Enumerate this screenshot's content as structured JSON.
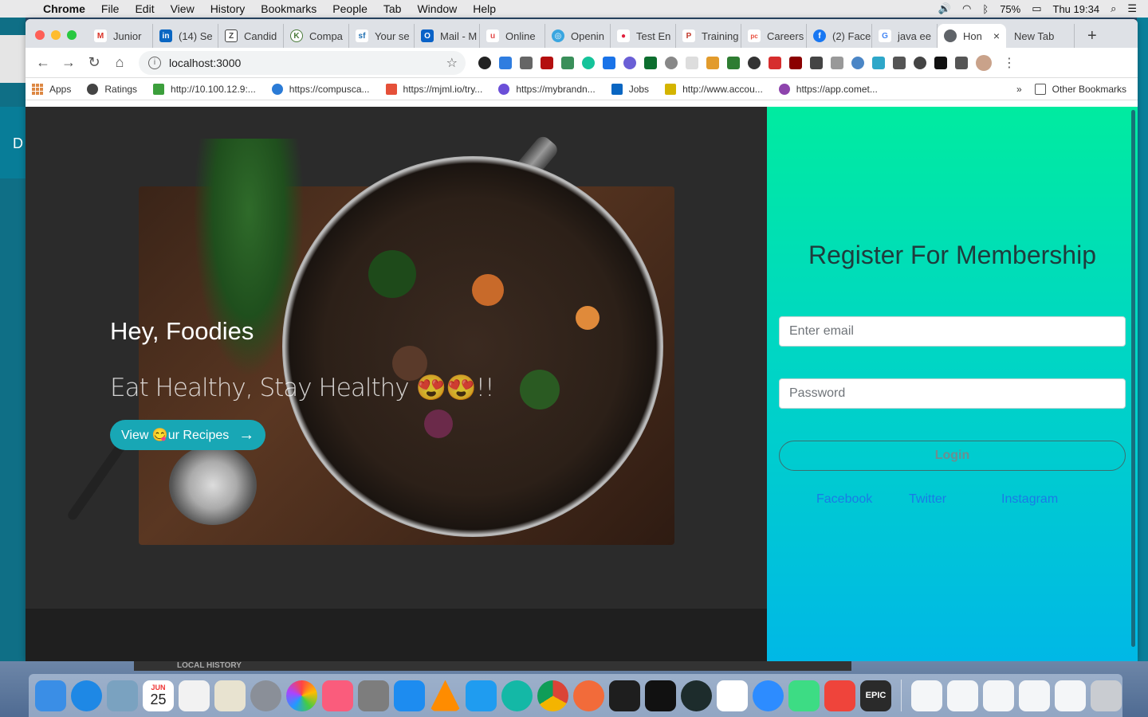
{
  "menubar": {
    "app_name": "Chrome",
    "items": [
      "File",
      "Edit",
      "View",
      "History",
      "Bookmarks",
      "People",
      "Tab",
      "Window",
      "Help"
    ],
    "battery": "75%",
    "clock": "Thu 19:34"
  },
  "tabs": [
    {
      "label": "Junior",
      "color": "#d93025",
      "glyph": "M"
    },
    {
      "label": "(14) Se",
      "color": "#0a66c2",
      "glyph": "in"
    },
    {
      "label": "Candid",
      "color": "#444444",
      "glyph": "Z"
    },
    {
      "label": "Compa",
      "color": "#4a7a3a",
      "glyph": "K"
    },
    {
      "label": "Your se",
      "color": "#1f6fb2",
      "glyph": "sf"
    },
    {
      "label": "Mail - M",
      "color": "#0a62c7",
      "glyph": "O"
    },
    {
      "label": "Online",
      "color": "#e34a4a",
      "glyph": "u"
    },
    {
      "label": "Openin",
      "color": "#3aa6e0",
      "glyph": "◎"
    },
    {
      "label": "Test En",
      "color": "#e01e3c",
      "glyph": "●"
    },
    {
      "label": "Training",
      "color": "#c0392b",
      "glyph": "P"
    },
    {
      "label": "Careers",
      "color": "#e84d3d",
      "glyph": "pc"
    },
    {
      "label": "(2) Face",
      "color": "#1877f2",
      "glyph": "f"
    },
    {
      "label": "java ee",
      "color": "#4285f4",
      "glyph": "G"
    }
  ],
  "active_tab": {
    "label": "Hon",
    "close": "×"
  },
  "new_tab": {
    "label": "New Tab",
    "plus": "+"
  },
  "address": {
    "url": "localhost:3000"
  },
  "bookmarks": [
    {
      "label": "Apps"
    },
    {
      "label": "Ratings",
      "color": "#444"
    },
    {
      "label": "http://10.100.12.9:...",
      "color": "#3c9f3c"
    },
    {
      "label": "https://compusca...",
      "color": "#2b7bd6"
    },
    {
      "label": "https://mjml.io/try...",
      "color": "#e55039"
    },
    {
      "label": "https://mybrandn...",
      "color": "#6b4fd8"
    },
    {
      "label": "Jobs",
      "color": "#0a66c2"
    },
    {
      "label": "http://www.accou...",
      "color": "#d4b400"
    },
    {
      "label": "https://app.comet...",
      "color": "#8e44ad"
    }
  ],
  "bookmarks_more": "»",
  "other_bookmarks": "Other Bookmarks",
  "background_window_letter": "D",
  "hero": {
    "title": "Hey, Foodies",
    "subtitle": "Eat Healthy, Stay Healthy 😍😍!!",
    "button_label": "View 😋ur Recipes",
    "button_arrow": "→"
  },
  "register": {
    "title": "Register For Membership",
    "email_placeholder": "Enter email",
    "password_placeholder": "Password",
    "login_label": "Login",
    "social": [
      "Facebook",
      "Twitter",
      "Instagram"
    ]
  },
  "dock": {
    "local_history_label": "LOCAL HISTORY",
    "calendar_month": "JUN",
    "calendar_day": "25",
    "apps": [
      {
        "name": "finder",
        "color": "#3a8ee6"
      },
      {
        "name": "safari",
        "color": "#1e88e5"
      },
      {
        "name": "preview",
        "color": "#7aa2c0"
      },
      {
        "name": "calendar",
        "color": "#ffffff"
      },
      {
        "name": "reminders",
        "color": "#f2f2f2"
      },
      {
        "name": "maps",
        "color": "#e8e3d0"
      },
      {
        "name": "launchpad",
        "color": "#8a8f98"
      },
      {
        "name": "photos",
        "color": "#ffffff"
      },
      {
        "name": "music",
        "color": "#fa5c7c"
      },
      {
        "name": "system-preferences",
        "color": "#7d7d7d"
      },
      {
        "name": "app-store",
        "color": "#1d8cf0"
      },
      {
        "name": "vlc",
        "color": "#ff8c00"
      },
      {
        "name": "vscode",
        "color": "#1f9cf0"
      },
      {
        "name": "teal-app",
        "color": "#14b8a6"
      },
      {
        "name": "chrome",
        "color": "#ffffff"
      },
      {
        "name": "sketch-pen",
        "color": "#f26b3a"
      },
      {
        "name": "terminal",
        "color": "#1e1e1e"
      },
      {
        "name": "pycharm",
        "color": "#111111"
      },
      {
        "name": "gitkraken",
        "color": "#1d2c2c"
      },
      {
        "name": "slack",
        "color": "#ffffff"
      },
      {
        "name": "zoom-like",
        "color": "#2d8cff"
      },
      {
        "name": "android-studio",
        "color": "#3ddc84"
      },
      {
        "name": "anydesk",
        "color": "#ef443b"
      },
      {
        "name": "epic-games",
        "color": "#2a2a2a"
      }
    ],
    "epic_label": "EPIC"
  }
}
